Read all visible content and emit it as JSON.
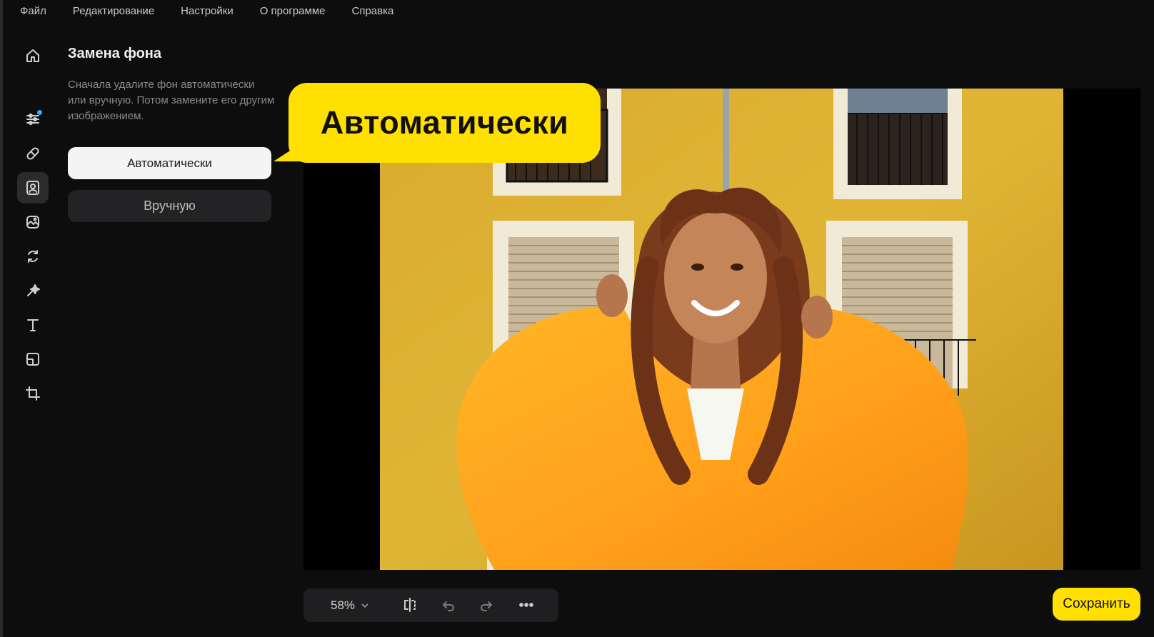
{
  "menu": [
    "Файл",
    "Редактирование",
    "Настройки",
    "О программе",
    "Справка"
  ],
  "rail": [
    {
      "icon": "home-icon"
    },
    {
      "icon": "sliders-icon",
      "badge": true
    },
    {
      "icon": "bandage-icon"
    },
    {
      "icon": "portrait-icon",
      "active": true
    },
    {
      "icon": "image-edit-icon"
    },
    {
      "icon": "replace-icon"
    },
    {
      "icon": "magic-icon"
    },
    {
      "icon": "text-icon"
    },
    {
      "icon": "layout-icon"
    },
    {
      "icon": "crop-icon"
    }
  ],
  "panel": {
    "title": "Замена фона",
    "description": "Сначала удалите фон автоматически или вручную. Потом замените его другим изображением.",
    "auto_label": "Автоматически",
    "manual_label": "Вручную"
  },
  "callout": {
    "text": "Автоматически"
  },
  "toolbar": {
    "zoom": "58%",
    "save_label": "Сохранить"
  },
  "colors": {
    "accent": "#ffe000",
    "background": "#0d0d0d",
    "active_dot": "#3ea6ff"
  }
}
